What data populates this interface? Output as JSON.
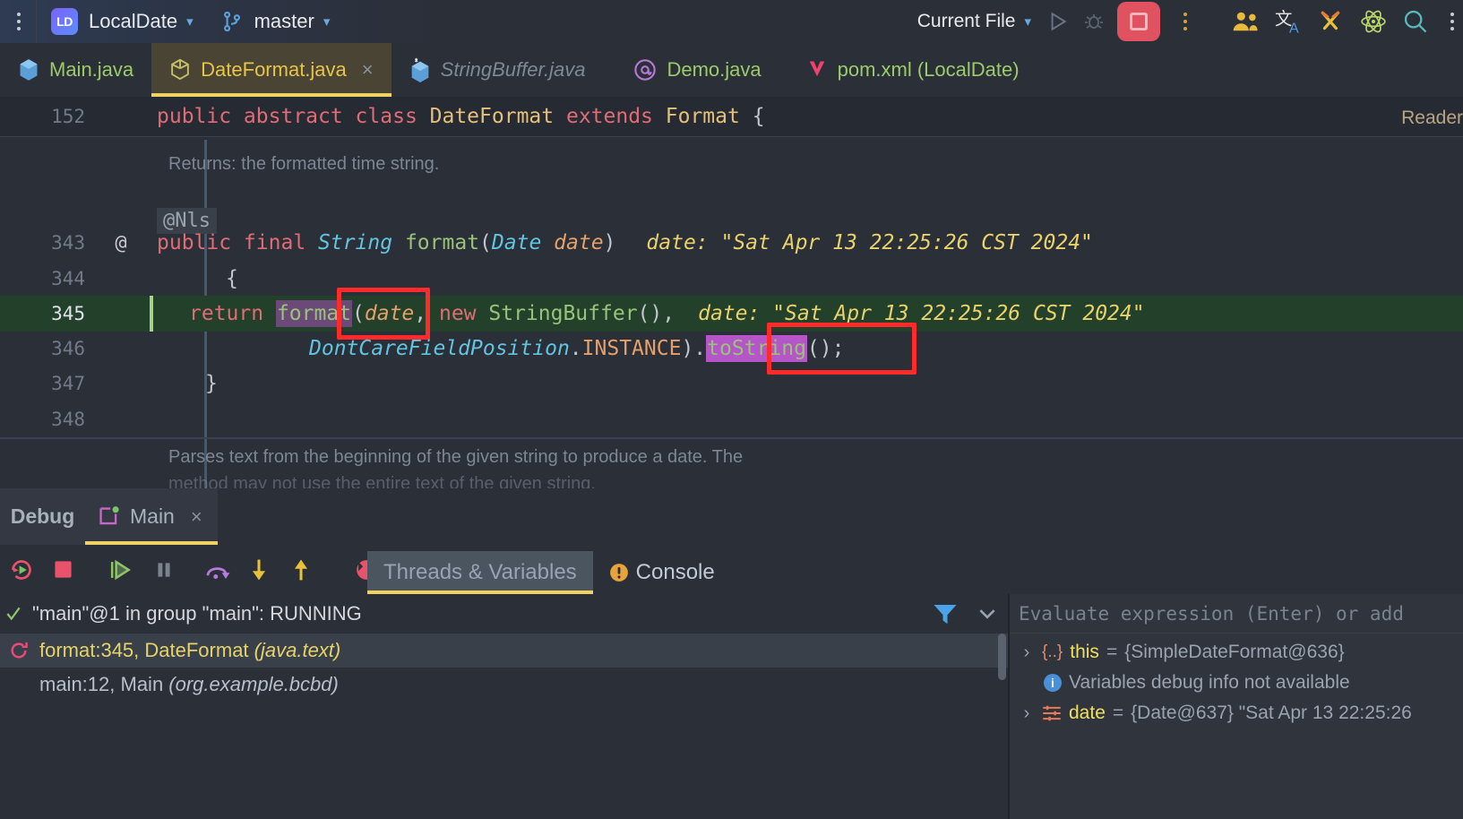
{
  "topbar": {
    "menu_icon": "kebab-menu-icon",
    "project_badge": "LD",
    "project_name": "LocalDate",
    "branch_icon": "git-branch-icon",
    "branch_name": "master",
    "run_config": "Current File",
    "run_icon": "run-icon",
    "debug_icon": "debug-icon",
    "stop_icon": "stop-icon",
    "more_icon": "more-vertical-icon",
    "actions": [
      {
        "name": "users-icon",
        "glyph": "👥"
      },
      {
        "name": "translate-icon",
        "glyph": "文"
      },
      {
        "name": "tools-icon",
        "glyph": "⚒"
      },
      {
        "name": "atom-icon",
        "glyph": "⚛"
      },
      {
        "name": "search-icon",
        "glyph": "⌕"
      }
    ]
  },
  "tabs": [
    {
      "label": "Main.java",
      "icon": "java-class-icon",
      "state": "normal",
      "closable": false
    },
    {
      "label": "DateFormat.java",
      "icon": "abstract-class-icon",
      "state": "active",
      "closable": true
    },
    {
      "label": "StringBuffer.java",
      "icon": "java-class-icon",
      "state": "italic",
      "closable": false
    },
    {
      "label": "Demo.java",
      "icon": "annotation-icon",
      "state": "normal",
      "closable": false
    },
    {
      "label": "pom.xml (LocalDate)",
      "icon": "maven-icon",
      "state": "normal",
      "closable": false
    }
  ],
  "editor": {
    "reader_label": "Reader",
    "sticky_line": {
      "number": "152",
      "tokens": [
        {
          "t": "public abstract class ",
          "c": "k"
        },
        {
          "t": "DateFormat ",
          "c": "ty"
        },
        {
          "t": "extends ",
          "c": "k"
        },
        {
          "t": "Format ",
          "c": "ty"
        },
        {
          "t": "{",
          "c": "pu"
        }
      ]
    },
    "doc_text_top": "Returns: the formatted time string.",
    "annotation": "@Nls",
    "lines": [
      {
        "number": "343",
        "gutter": "@"
      },
      {
        "number": "344",
        "gutter": ""
      },
      {
        "number": "345",
        "gutter": "",
        "current": true
      },
      {
        "number": "346",
        "gutter": ""
      },
      {
        "number": "347",
        "gutter": ""
      },
      {
        "number": "348",
        "gutter": ""
      }
    ],
    "line343": [
      {
        "t": "public final ",
        "c": "k"
      },
      {
        "t": "String ",
        "c": "cy"
      },
      {
        "t": "format",
        "c": "fn"
      },
      {
        "t": "(",
        "c": "pu"
      },
      {
        "t": "Date ",
        "c": "cy"
      },
      {
        "t": "date",
        "c": "pa"
      },
      {
        "t": ")",
        "c": "pu"
      }
    ],
    "line343_hint": "date:  \"Sat Apr 13 22:25:26 CST 2024\"",
    "line344": "{",
    "line345_pre": "return ",
    "line345_highlight": "format",
    "line345_post_a": "(",
    "line345_post_date": "date",
    "line345_post_b": ", ",
    "line345_new": "new ",
    "line345_sb": "StringBuffer",
    "line345_post_c": "(),",
    "line345_hint": "date: \"Sat Apr 13 22:25:26 CST 2024\"",
    "line346_cls": "DontCareFieldPosition",
    "line346_dot1": ".",
    "line346_inst": "INSTANCE",
    "line346_close": ").",
    "line346_highlight": "toString",
    "line346_tail": "();",
    "line347": "}",
    "doc_text_bottom_1": "Parses text from the beginning of the given string to produce a date. The",
    "doc_text_bottom_2": "method may not use the entire text of the given string."
  },
  "debug": {
    "panel_title": "Debug",
    "tab_label": "Main",
    "tab_icon": "run-config-icon",
    "tab_close": "×",
    "toolbar": [
      {
        "name": "rerun-icon"
      },
      {
        "name": "stop-icon"
      },
      {
        "name": "resume-icon"
      },
      {
        "name": "pause-icon"
      },
      {
        "name": "step-over-icon"
      },
      {
        "name": "step-into-icon"
      },
      {
        "name": "step-out-icon"
      },
      {
        "name": "breakpoint-icon"
      },
      {
        "name": "mute-breakpoints-icon"
      },
      {
        "name": "more-options-icon"
      }
    ],
    "sub_tabs": [
      {
        "label": "Threads & Variables",
        "selected": true,
        "icon": null
      },
      {
        "label": "Console",
        "selected": false,
        "icon": "warning-icon"
      }
    ],
    "thread_label": "\"main\"@1 in group \"main\": RUNNING",
    "thread_icon": "thread-running-icon",
    "filter_icon": "filter-icon",
    "collapse_icon": "chevron-down-icon",
    "frames": [
      {
        "icon": "frame-current-icon",
        "text": "format:345, DateFormat ",
        "italic": "(java.text)",
        "selected": true,
        "active": true
      },
      {
        "icon": "",
        "text": "main:12, Main ",
        "italic": "(org.example.bcbd)",
        "selected": false,
        "active": false
      }
    ],
    "evaluate_placeholder": "Evaluate expression (Enter) or add",
    "variables": [
      {
        "arrow": "›",
        "icon": "object-icon",
        "icon_text": "{..}",
        "name": "this",
        "eq": " = ",
        "value": "{SimpleDateFormat@636}"
      },
      {
        "arrow": "",
        "icon": "info-icon",
        "icon_text": "i",
        "name": "",
        "eq": "",
        "value": "Variables debug info not available"
      },
      {
        "arrow": "›",
        "icon": "field-icon",
        "icon_text": "",
        "name": "date",
        "eq": " = ",
        "value": "{Date@637} \"Sat Apr 13 22:25:26"
      }
    ]
  },
  "colors": {
    "accent_yellow": "#f0d264",
    "error_red": "#ff2a2a",
    "selection_violet": "#6b4a7a",
    "selection_magenta": "#b455c8",
    "current_line_green": "#23402b"
  }
}
